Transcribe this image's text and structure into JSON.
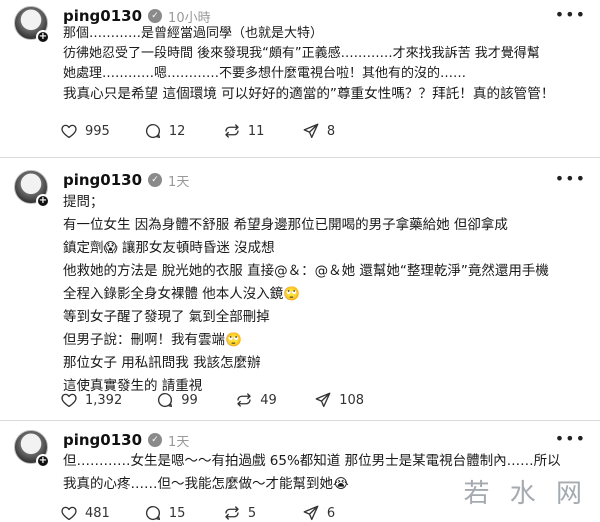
{
  "posts": [
    {
      "username": "ping0130",
      "time": "10小時",
      "lines": [
        "那個…………是曾經當過同學（也就是大特）",
        "彷彿她忍受了一段時間 後來發現我“頗有”正義感…………才來找我訴苦 我才覺得幫",
        "她處理…………嗯…………不要多想什麼電視台啦！其他有的沒的……",
        "我真心只是希望 這個環境 可以好好的適當的”尊重女性嗎？？拜託！真的該管管！"
      ],
      "likes": "995",
      "comments": "12",
      "reposts": "11",
      "shares": "8"
    },
    {
      "username": "ping0130",
      "time": "1天",
      "lines": [
        "提問；",
        "有一位女生 因為身體不舒服 希望身邊那位已開喝的男子拿藥給她 但卻拿成",
        "鎮定劑😱 讓那女友頓時昏迷 沒成想",
        "他救她的方法是 脫光她的衣服 直接@＆：@＆她 還幫她“整理乾淨”竟然還用手機",
        "全程入錄影全身女裸體 他本人沒入鏡🙄",
        "等到女子醒了發現了 氣到全部刪掉",
        "但男子說：刪啊！我有雲端🙄",
        "那位女子 用私訊問我 我該怎麼辦",
        "這使真實發生的 請重視"
      ],
      "likes": "1,392",
      "comments": "99",
      "reposts": "49",
      "shares": "108"
    },
    {
      "username": "ping0130",
      "time": "1天",
      "lines": [
        "但…………女生是嗯～～有拍過戲 65%都知道 那位男士是某電視台體制內……所以",
        "我真的心疼……但～我能怎麼做～才能幫到她😭"
      ],
      "likes": "481",
      "comments": "15",
      "reposts": "5",
      "shares": "6"
    }
  ],
  "watermark": "若 水 网",
  "icons": {
    "like": "heart-icon",
    "comment": "comment-icon",
    "repost": "repost-icon",
    "share": "send-icon",
    "more": "more-icon",
    "follow": "plus-icon"
  }
}
